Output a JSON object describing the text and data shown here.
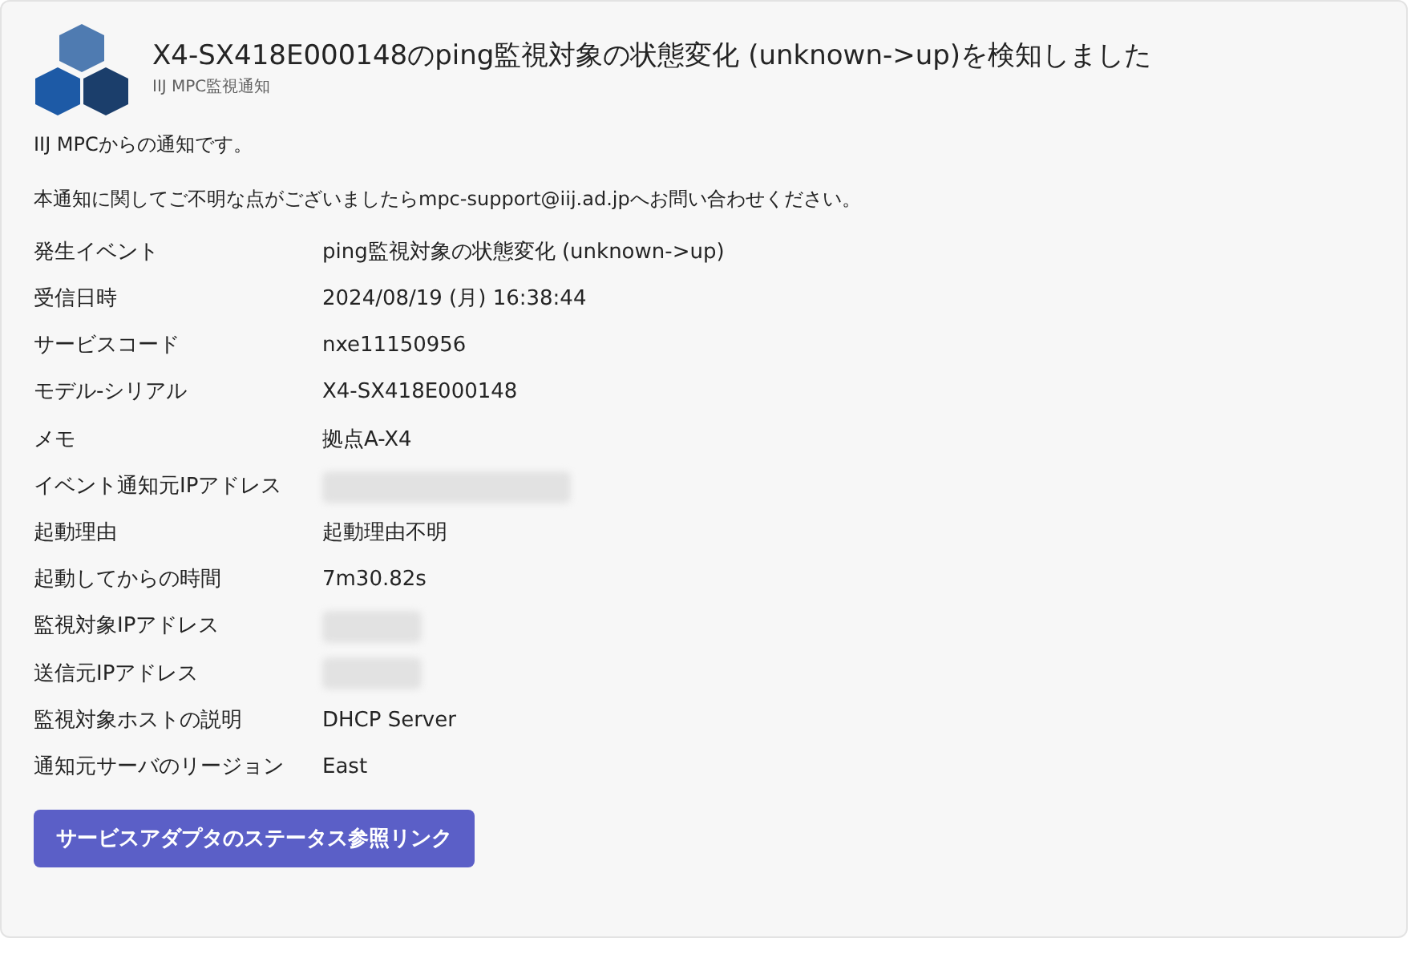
{
  "header": {
    "title": "X4-SX418E000148のping監視対象の状態変化 (unknown->up)を検知しました",
    "subtitle": "IIJ MPC監視通知"
  },
  "intro": [
    "IIJ MPCからの通知です。",
    "本通知に関してご不明な点がございましたらmpc-support@iij.ad.jpへお問い合わせください。"
  ],
  "facts": [
    {
      "label": "発生イベント",
      "kind": "text",
      "value": "ping監視対象の状態変化 (unknown->up)"
    },
    {
      "label": "受信日時",
      "kind": "text",
      "value": "2024/08/19 (月) 16:38:44"
    },
    {
      "label": "サービスコード",
      "kind": "text",
      "value": "nxe11150956"
    },
    {
      "label": "モデル-シリアル",
      "kind": "text",
      "value": "X4-SX418E000148"
    },
    {
      "label": "メモ",
      "kind": "text",
      "value": "拠点A-X4"
    },
    {
      "label": "イベント通知元IPアドレス",
      "kind": "redacted"
    },
    {
      "label": "起動理由",
      "kind": "text",
      "value": "起動理由不明"
    },
    {
      "label": "起動してからの時間",
      "kind": "text",
      "value": "7m30.82s"
    },
    {
      "label": "監視対象IPアドレス",
      "kind": "redacted_short"
    },
    {
      "label": "送信元IPアドレス",
      "kind": "redacted_short"
    },
    {
      "label": "監視対象ホストの説明",
      "kind": "text",
      "value": "DHCP Server"
    },
    {
      "label": "通知元サーバのリージョン",
      "kind": "text",
      "value": "East"
    }
  ],
  "action_button": "サービスアダプタのステータス参照リンク"
}
